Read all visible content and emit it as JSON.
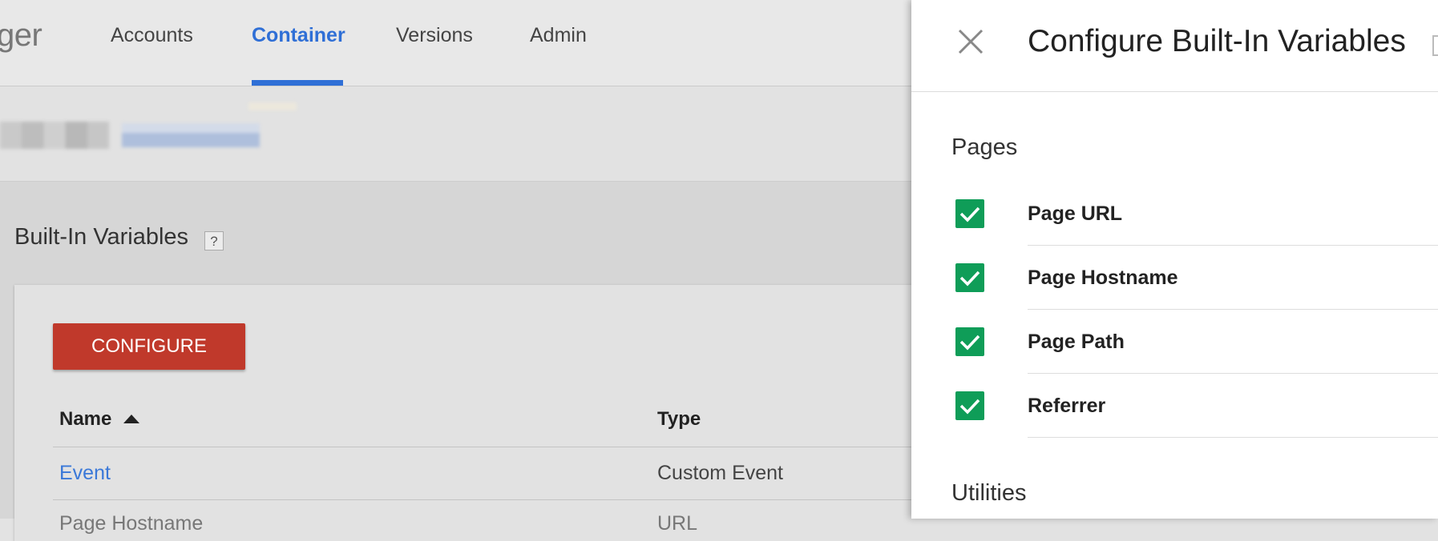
{
  "app": {
    "logo_fragment": "ger"
  },
  "nav": {
    "tabs": [
      {
        "label": "Accounts"
      },
      {
        "label": "Container"
      },
      {
        "label": "Versions"
      },
      {
        "label": "Admin"
      }
    ],
    "active_index": 1
  },
  "main": {
    "section_title": "Built-In Variables",
    "help": "?",
    "configure_button": "CONFIGURE",
    "table": {
      "columns": [
        "Name",
        "Type"
      ],
      "rows": [
        {
          "name": "Event",
          "type": "Custom Event"
        },
        {
          "name": "Page Hostname",
          "type": "URL"
        }
      ]
    }
  },
  "panel": {
    "title": "Configure Built-In Variables",
    "groups": [
      {
        "title": "Pages",
        "items": [
          {
            "label": "Page URL",
            "checked": true
          },
          {
            "label": "Page Hostname",
            "checked": true
          },
          {
            "label": "Page Path",
            "checked": true
          },
          {
            "label": "Referrer",
            "checked": true
          }
        ]
      },
      {
        "title": "Utilities",
        "items": []
      }
    ]
  },
  "colors": {
    "accent": "#2f6fd6",
    "configure_button": "#c0392b",
    "checkbox": "#0f9d58"
  }
}
